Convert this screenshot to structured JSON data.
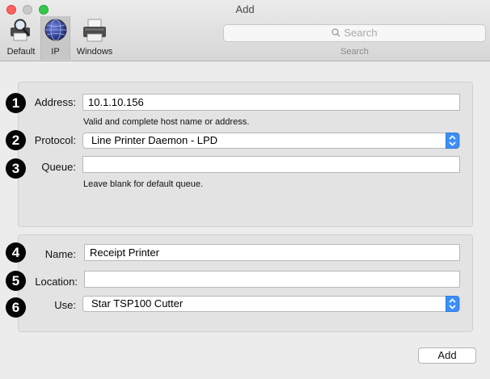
{
  "window": {
    "title": "Add"
  },
  "toolbar": {
    "items": [
      {
        "label": "Default",
        "icon": "printer-magnifier-icon"
      },
      {
        "label": "IP",
        "icon": "globe-icon",
        "selected": true
      },
      {
        "label": "Windows",
        "icon": "printer-icon"
      }
    ],
    "search": {
      "placeholder": "Search",
      "caption": "Search"
    }
  },
  "form": {
    "address": {
      "badge": "1",
      "label": "Address:",
      "value": "10.1.10.156",
      "hint": "Valid and complete host name or address."
    },
    "protocol": {
      "badge": "2",
      "label": "Protocol:",
      "value": "Line Printer Daemon - LPD"
    },
    "queue": {
      "badge": "3",
      "label": "Queue:",
      "value": "",
      "hint": "Leave blank for default queue."
    },
    "name": {
      "badge": "4",
      "label": "Name:",
      "value": "Receipt Printer"
    },
    "location": {
      "badge": "5",
      "label": "Location:",
      "value": ""
    },
    "use": {
      "badge": "6",
      "label": "Use:",
      "value": "Star TSP100 Cutter"
    }
  },
  "actions": {
    "add_label": "Add"
  },
  "colors": {
    "accent": "#3d8ef7",
    "close": "#fc605c",
    "maximize": "#34c84a"
  }
}
